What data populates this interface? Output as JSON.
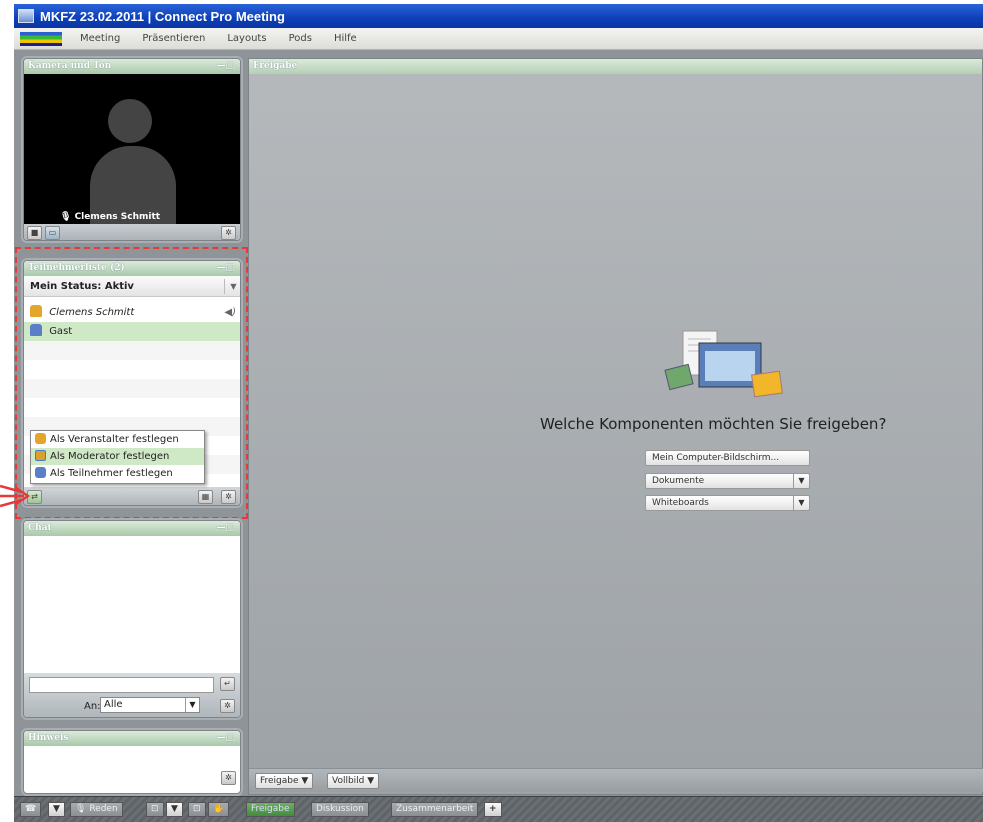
{
  "window": {
    "title": "MKFZ 23.02.2011 | Connect Pro Meeting"
  },
  "menu": [
    "Meeting",
    "Präsentieren",
    "Layouts",
    "Pods",
    "Hilfe"
  ],
  "camera_pod": {
    "title": "Kamera und Ton",
    "user_name": "Clemens Schmitt",
    "controls": "—□"
  },
  "attendee_pod": {
    "title": "Teilnehmerliste (2)",
    "controls": "—□",
    "my_status": "Mein Status: Aktiv",
    "attendees": [
      {
        "name": "Clemens Schmitt",
        "role": "host",
        "italic": true
      },
      {
        "name": "Gast",
        "role": "participant",
        "selected": true
      }
    ]
  },
  "role_menu": {
    "items": [
      {
        "label": "Als Veranstalter festlegen",
        "icon": "host-icon"
      },
      {
        "label": "Als Moderator festlegen",
        "icon": "presenter-icon",
        "highlighted": true
      },
      {
        "label": "Als Teilnehmer festlegen",
        "icon": "participant-icon"
      }
    ]
  },
  "chat_pod": {
    "title": "Chat",
    "controls": "—□",
    "to_label": "An:",
    "to_value": "Alle"
  },
  "hint_pod": {
    "title": "Hinweis",
    "controls": "—□"
  },
  "share_pod": {
    "title": "Freigabe",
    "question": "Welche Komponenten möchten Sie freigeben?",
    "buttons": [
      "Mein Computer-Bildschirm...",
      "Dokumente",
      "Whiteboards"
    ],
    "footer": [
      "Freigabe",
      "Vollbild"
    ]
  },
  "bottom_bar": {
    "speak": "Reden",
    "tabs": [
      "Freigabe",
      "Diskussion",
      "Zusammenarbeit"
    ],
    "add": "+"
  },
  "colors": {
    "title_bar": "#0d3fb8",
    "pod_header": "#a9c9a9",
    "highlight": "#cfe9c7",
    "annotation": "#e63a3a"
  }
}
